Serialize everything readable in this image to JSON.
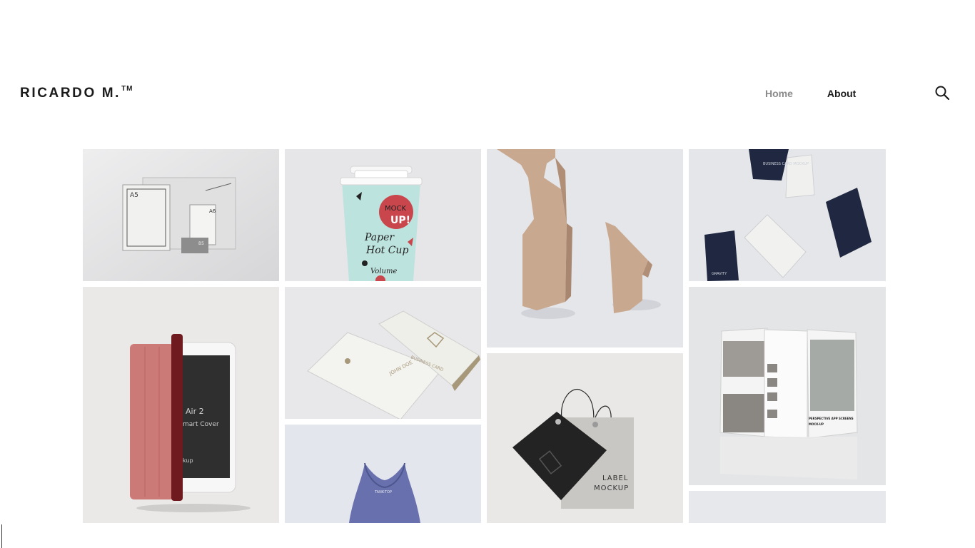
{
  "site": {
    "logo_text": "RICARDO M.",
    "logo_mark": "TM"
  },
  "nav": {
    "items": [
      {
        "label": "Home",
        "active": false
      },
      {
        "label": "About",
        "active": true
      }
    ],
    "search_icon": "search-icon"
  },
  "gallery": {
    "cup": {
      "line1": "MOCK",
      "line2": "UP!",
      "line3": "Paper",
      "line4": "Hot Cup",
      "line5": "Volume"
    },
    "stationery": {
      "a5": "A5",
      "a6": "A6",
      "b5": "B5"
    },
    "cards": {
      "brand": "GRAVITY",
      "sub": "BUSINESS CARD MOCKUP"
    },
    "tablet": {
      "line1": "Air 2",
      "line2": "mart Cover",
      "line3": "kup"
    },
    "business_card": {
      "title": "BUSINESS CARD",
      "name": "JOHN DOE"
    },
    "tank": {
      "label": "TANK-TOP"
    },
    "label_tag": {
      "line1": "LABEL",
      "line2": "MOCKUP"
    },
    "app_screens": {
      "caption1": "PERSPECTIVE APP SCREENS",
      "caption2": "MOCK-UP"
    }
  },
  "colors": {
    "nav_inactive": "#8a8a8a",
    "nav_active": "#1a1a1a",
    "tile_bg": "#e8e8ea"
  }
}
